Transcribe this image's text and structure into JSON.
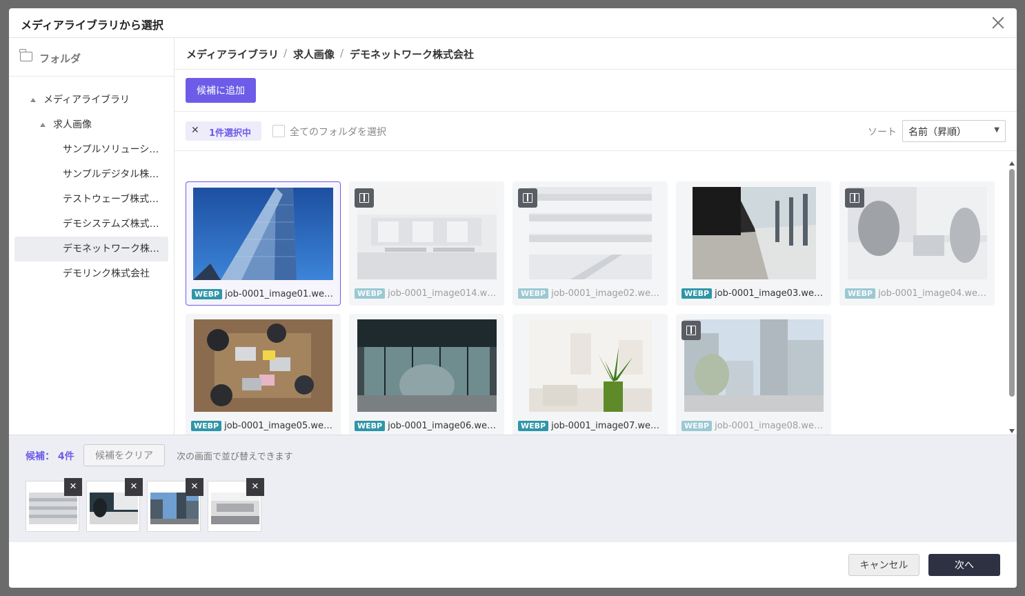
{
  "modal": {
    "title": "メディアライブラリから選択"
  },
  "sidebar": {
    "title": "フォルダ",
    "tree": [
      {
        "label": "メディアライブラリ",
        "level": 0
      },
      {
        "label": "求人画像",
        "level": 1
      },
      {
        "label": "サンプルソリューシ…",
        "level": 2
      },
      {
        "label": "サンプルデジタル株…",
        "level": 2
      },
      {
        "label": "テストウェーブ株式…",
        "level": 2
      },
      {
        "label": "デモシステムズ株式…",
        "level": 2
      },
      {
        "label": "デモネットワーク株…",
        "level": 2,
        "selected": true
      },
      {
        "label": "デモリンク株式会社",
        "level": 2
      }
    ]
  },
  "breadcrumb": {
    "items": [
      "メディアライブラリ",
      "求人画像",
      "デモネットワーク株式会社"
    ],
    "separator": "/"
  },
  "toolbar": {
    "add_candidate": "候補に追加",
    "selected_text": "1件選択中",
    "select_all_folders": "全てのフォルダを選択",
    "sort_label": "ソート",
    "sort_value": "名前（昇順）"
  },
  "images": [
    {
      "format": "WEBP",
      "name": "job-0001_image01.we…",
      "selected": true,
      "in_candidates": false
    },
    {
      "format": "WEBP",
      "name": "job-0001_image014.w…",
      "selected": false,
      "in_candidates": true
    },
    {
      "format": "WEBP",
      "name": "job-0001_image02.we…",
      "selected": false,
      "in_candidates": true
    },
    {
      "format": "WEBP",
      "name": "job-0001_image03.we…",
      "selected": false,
      "in_candidates": false
    },
    {
      "format": "WEBP",
      "name": "job-0001_image04.we…",
      "selected": false,
      "in_candidates": true
    },
    {
      "format": "WEBP",
      "name": "job-0001_image05.we…",
      "selected": false,
      "in_candidates": false
    },
    {
      "format": "WEBP",
      "name": "job-0001_image06.we…",
      "selected": false,
      "in_candidates": false
    },
    {
      "format": "WEBP",
      "name": "job-0001_image07.we…",
      "selected": false,
      "in_candidates": false
    },
    {
      "format": "WEBP",
      "name": "job-0001_image08.we…",
      "selected": false,
      "in_candidates": true
    }
  ],
  "candidates": {
    "label": "候補： 4件",
    "clear_button": "候補をクリア",
    "note": "次の画面で並び替えできます",
    "remove_symbol": "✕"
  },
  "footer": {
    "cancel": "キャンセル",
    "next": "次へ"
  },
  "colors": {
    "accent": "#6d5ce7",
    "webp_badge": "#2f96a8",
    "dark_button": "#2e3142"
  },
  "icons": {
    "close": "close-icon",
    "folder": "folder-icon",
    "candidate_badge": "candidate-grid-icon"
  }
}
